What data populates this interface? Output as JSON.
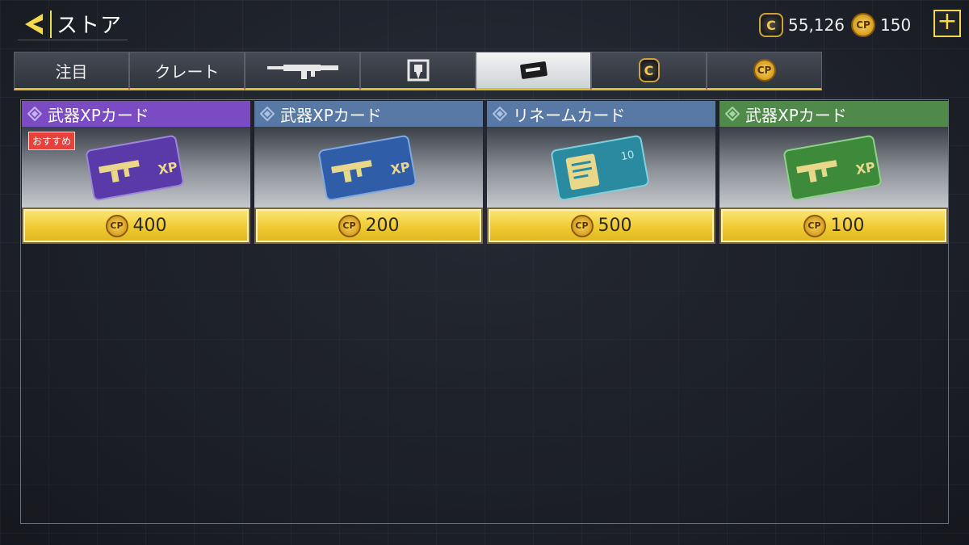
{
  "header": {
    "title": "ストア",
    "credits": "55,126",
    "cp": "150",
    "credit_icon_text": "C",
    "cp_icon_text": "CP",
    "plus_label": "+"
  },
  "tabs": [
    {
      "label": "注目",
      "icon": null
    },
    {
      "label": "クレート",
      "icon": null
    },
    {
      "label": "",
      "icon": "rifle-icon"
    },
    {
      "label": "",
      "icon": "card-icon"
    },
    {
      "label": "",
      "icon": "ticket-icon",
      "active": true
    },
    {
      "label": "C",
      "icon": "credit-coin-icon"
    },
    {
      "label": "CP",
      "icon": "cp-coin-icon"
    }
  ],
  "items": [
    {
      "name": "武器XPカード",
      "price": "400",
      "badge": "おすすめ",
      "color": "#7b4bc4",
      "card_color": "#5a3aa8",
      "art_text": "XP"
    },
    {
      "name": "武器XPカード",
      "price": "200",
      "badge": "",
      "color": "#5878a6",
      "card_color": "#2f5da8",
      "art_text": "XP"
    },
    {
      "name": "リネームカード",
      "price": "500",
      "badge": "",
      "color": "#5878a6",
      "card_color": "#2a8aa0",
      "art_text": "10"
    },
    {
      "name": "武器XPカード",
      "price": "100",
      "badge": "",
      "color": "#4f8a4a",
      "card_color": "#3c8a3a",
      "art_text": "XP"
    }
  ],
  "price_icon_text": "CP",
  "colors": {
    "accent": "#f2d94e",
    "price_bar": "#f1cc36"
  }
}
